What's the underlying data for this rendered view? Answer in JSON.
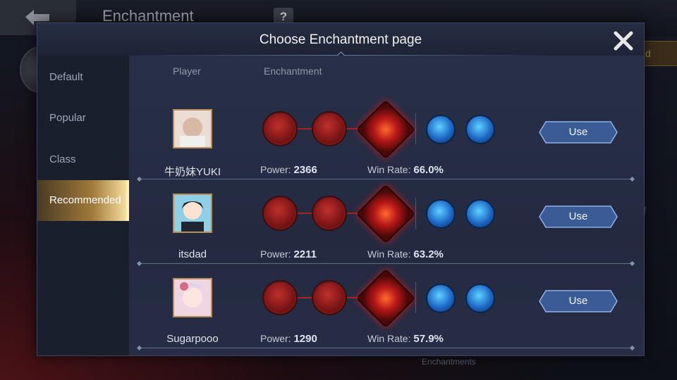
{
  "background": {
    "screen_title": "Enchantment",
    "help_label": "?",
    "right_button_partial": "d",
    "right_text_partial": "f",
    "footer_label": "Enchantments"
  },
  "modal": {
    "title": "Choose Enchantment page",
    "close_icon": "close-icon"
  },
  "sidebar": {
    "items": [
      {
        "label": "Default",
        "active": false
      },
      {
        "label": "Popular",
        "active": false
      },
      {
        "label": "Class",
        "active": false
      },
      {
        "label": "Recommended",
        "active": true
      }
    ]
  },
  "table": {
    "headers": {
      "player": "Player",
      "enchantment": "Enchantment"
    },
    "power_label": "Power:",
    "winrate_label": "Win Rate:",
    "use_label": "Use",
    "rows": [
      {
        "player": "牛奶妹YUKI",
        "power": "2366",
        "win_rate": "66.0%",
        "avatar_color": "#d8b9a6"
      },
      {
        "player": "itsdad",
        "power": "2211",
        "win_rate": "63.2%",
        "avatar_color": "#8fd0e6"
      },
      {
        "player": "Sugarpooo",
        "power": "1290",
        "win_rate": "57.9%",
        "avatar_color": "#d99ab6"
      }
    ],
    "skills": [
      "sprint-icon",
      "spearhead-icon",
      "core-rune-icon",
      "blue-wave-icon",
      "blue-feather-icon"
    ]
  },
  "colors": {
    "accent_gold": "#a07a3a",
    "skill_red": "#b81818",
    "skill_blue": "#1c68c7",
    "button_blue": "#3a5b96"
  }
}
